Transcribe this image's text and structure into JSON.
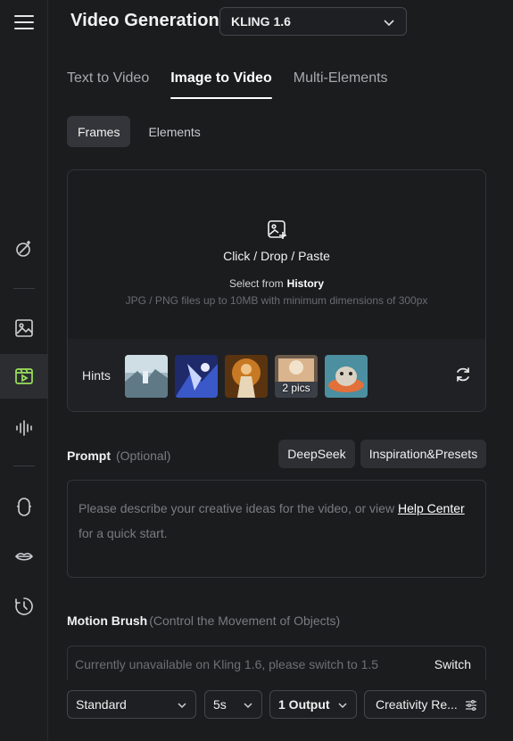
{
  "header": {
    "title": "Video Generation",
    "model": "KLING 1.6"
  },
  "sidebar": {
    "items": [
      {
        "name": "menu",
        "icon": "menu-icon"
      },
      {
        "name": "magic",
        "icon": "magic-wand-icon"
      },
      {
        "name": "image",
        "icon": "image-icon"
      },
      {
        "name": "video",
        "icon": "video-icon",
        "active": true
      },
      {
        "name": "audio",
        "icon": "audio-wave-icon"
      },
      {
        "name": "avatar",
        "icon": "avatar-icon"
      },
      {
        "name": "lipsync",
        "icon": "lips-icon"
      },
      {
        "name": "history",
        "icon": "history-icon"
      }
    ],
    "active_color": "#9be15d"
  },
  "tabs": [
    {
      "label": "Text to Video"
    },
    {
      "label": "Image to Video",
      "active": true
    },
    {
      "label": "Multi-Elements"
    }
  ],
  "subtabs": [
    {
      "label": "Frames",
      "active": true
    },
    {
      "label": "Elements"
    }
  ],
  "upload": {
    "main": "Click / Drop / Paste",
    "select_from": "Select from",
    "history": "History",
    "hint": "JPG / PNG files up to 10MB with minimum dimensions of 300px",
    "hints_label": "Hints",
    "thumb_badge": "2 pics"
  },
  "prompt": {
    "label": "Prompt",
    "optional": "(Optional)",
    "deepseek": "DeepSeek",
    "inspiration": "Inspiration&Presets",
    "placeholder_start": "Please describe your creative ideas for the video, or view ",
    "help_center": "Help Center",
    "placeholder_end": "for a quick start."
  },
  "motion_brush": {
    "label": "Motion Brush",
    "sub": "(Control the Movement of Objects)",
    "notice": "Currently unavailable on Kling 1.6, please switch to 1.5",
    "switch": "Switch"
  },
  "bottom": {
    "mode": "Standard",
    "duration": "5s",
    "outputs": "1 Output",
    "creativity": "Creativity Re..."
  }
}
